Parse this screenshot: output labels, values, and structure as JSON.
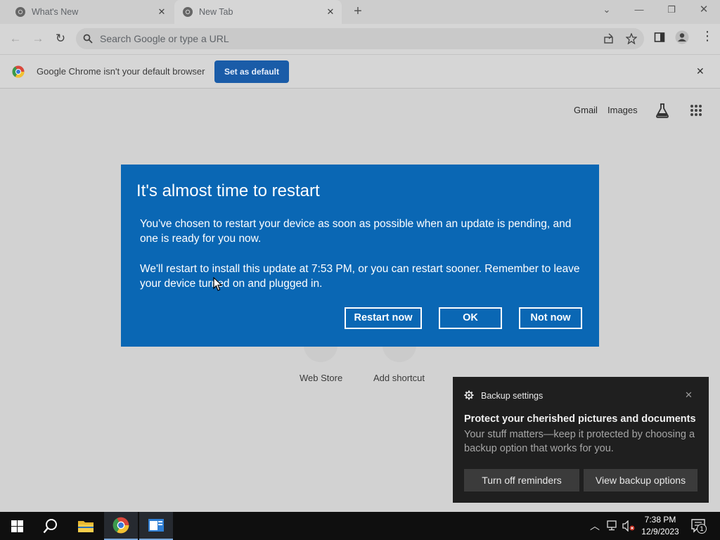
{
  "browser": {
    "tabs": [
      {
        "label": "What's New",
        "active": false
      },
      {
        "label": "New Tab",
        "active": true
      }
    ],
    "omnibox_placeholder": "Search Google or type a URL",
    "infobar": {
      "message": "Google Chrome isn't your default browser",
      "button": "Set as default"
    }
  },
  "ntp": {
    "links": [
      "Gmail",
      "Images"
    ],
    "shortcuts": [
      "Web Store",
      "Add shortcut"
    ]
  },
  "dialog": {
    "title": "It's almost time to restart",
    "paragraph1": "You've chosen to restart your device as soon as possible when an update is pending, and one is ready for you now.",
    "paragraph2": "We'll restart to install this update at 7:53 PM, or you can restart sooner. Remember to leave your device turned on and plugged in.",
    "buttons": {
      "restart": "Restart now",
      "ok": "OK",
      "not_now": "Not now"
    }
  },
  "toast": {
    "app": "Backup settings",
    "heading": "Protect your cherished pictures and documents",
    "body": "Your stuff matters—keep it protected by choosing a backup option that works for you.",
    "buttons": {
      "turn_off": "Turn off reminders",
      "view": "View backup options"
    }
  },
  "taskbar": {
    "time": "7:38 PM",
    "date": "12/9/2023",
    "notification_count": "1"
  },
  "colors": {
    "dialog_blue": "#0a67b4",
    "set_default_blue": "#1a5ca8",
    "toast_bg": "#1f1f1f"
  }
}
